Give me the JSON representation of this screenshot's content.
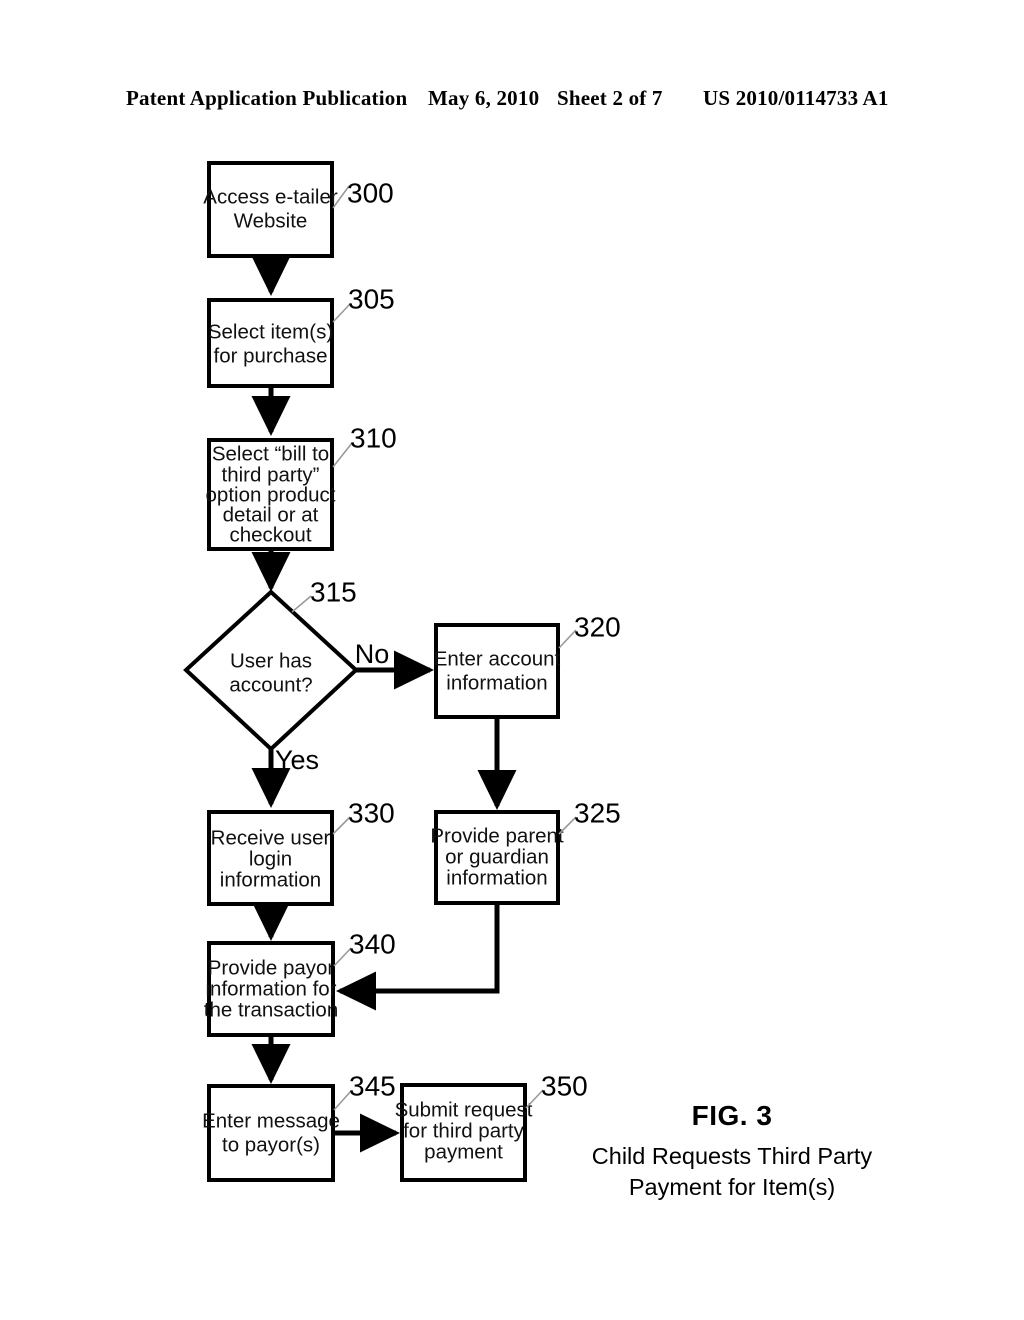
{
  "header": {
    "publication": "Patent Application Publication",
    "date": "May 6, 2010",
    "sheet": "Sheet 2 of 7",
    "publication_number": "US 2010/0114733 A1"
  },
  "figure": {
    "label": "FIG. 3",
    "title_line1": "Child Requests Third Party",
    "title_line2": "Payment for Item(s)"
  },
  "flowchart": {
    "nodes": [
      {
        "id": "n300",
        "ref": "300",
        "type": "process",
        "lines": [
          "Access e-tailer",
          "Website"
        ]
      },
      {
        "id": "n305",
        "ref": "305",
        "type": "process",
        "lines": [
          "Select item(s)",
          "for purchase"
        ]
      },
      {
        "id": "n310",
        "ref": "310",
        "type": "process",
        "lines": [
          "Select “bill to",
          "third party”",
          "option product",
          "detail or at",
          "checkout"
        ]
      },
      {
        "id": "n315",
        "ref": "315",
        "type": "decision",
        "lines": [
          "User has",
          "account?"
        ]
      },
      {
        "id": "n320",
        "ref": "320",
        "type": "process",
        "lines": [
          "Enter account",
          "information"
        ]
      },
      {
        "id": "n325",
        "ref": "325",
        "type": "process",
        "lines": [
          "Provide parent",
          "or guardian",
          "information"
        ]
      },
      {
        "id": "n330",
        "ref": "330",
        "type": "process",
        "lines": [
          "Receive user",
          "login",
          "information"
        ]
      },
      {
        "id": "n340",
        "ref": "340",
        "type": "process",
        "lines": [
          "Provide payor",
          "information for",
          "the transaction"
        ]
      },
      {
        "id": "n345",
        "ref": "345",
        "type": "process",
        "lines": [
          "Enter message",
          "to payor(s)"
        ]
      },
      {
        "id": "n350",
        "ref": "350",
        "type": "process",
        "lines": [
          "Submit request",
          "for third party",
          "payment"
        ]
      }
    ],
    "branch_labels": {
      "no": "No",
      "yes": "Yes"
    },
    "colors": {
      "stroke": "#000000",
      "fill": "#ffffff",
      "leader": "#9a9a9a"
    }
  }
}
